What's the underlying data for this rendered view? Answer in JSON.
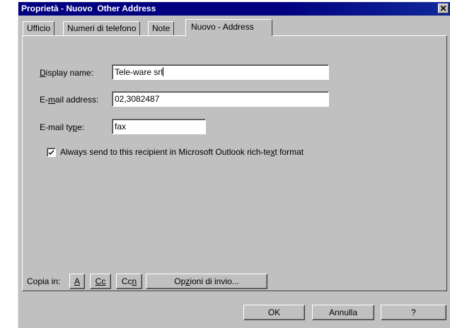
{
  "window": {
    "title": "Proprietà - Nuovo  Other Address",
    "close_glyph": "✕"
  },
  "tabs": [
    {
      "label": "Ufficio",
      "active": false
    },
    {
      "label": "Numeri di telefono",
      "active": false
    },
    {
      "label": "Note",
      "active": false
    },
    {
      "label": "Nuovo - Address",
      "active": true
    }
  ],
  "form": {
    "display_name_label": "Display name:",
    "display_name_value": "Tele-ware srl",
    "email_address_label": "E-mail address:",
    "email_address_value": "02,3082487",
    "email_type_label": "E-mail type:",
    "email_type_value": "fax",
    "rich_text_checkbox_label": "Always send to this recipient in Microsoft Outlook rich-text format",
    "rich_text_checked": true
  },
  "copy_in": {
    "label": "Copia in:",
    "a_label": "A",
    "cc_label": "Cc",
    "ccn_label": "Ccn",
    "send_options_label": "Opzioni di invio..."
  },
  "footer": {
    "ok_label": "OK",
    "cancel_label": "Annulla",
    "help_label": "?"
  }
}
